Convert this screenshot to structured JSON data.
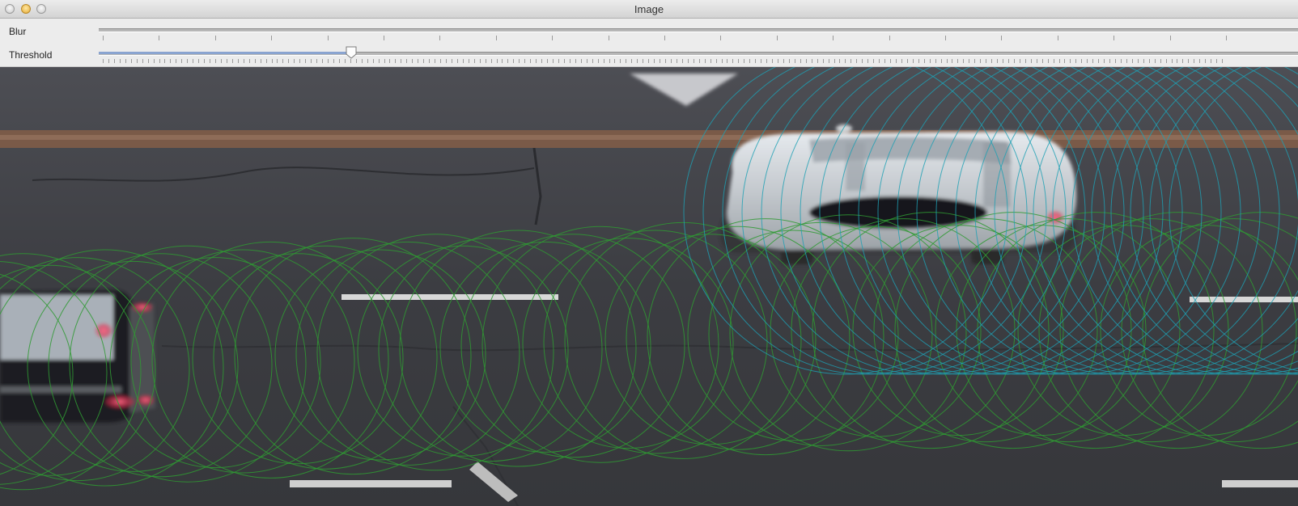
{
  "window": {
    "title": "Image",
    "buttons": [
      "close",
      "minimize",
      "zoom"
    ]
  },
  "controls": {
    "sliders": [
      {
        "label": "Blur",
        "value": 0,
        "tick_count": 21
      },
      {
        "label": "Threshold",
        "value": 0.135,
        "tick_count": 200
      }
    ]
  },
  "image": {
    "content": "road-scene-with-cars",
    "overlay_colors": {
      "green": "#2f9a32",
      "teal": "#1ea0b4"
    },
    "road_color": "#3f3f43",
    "car_color": "#c8cdd2"
  }
}
